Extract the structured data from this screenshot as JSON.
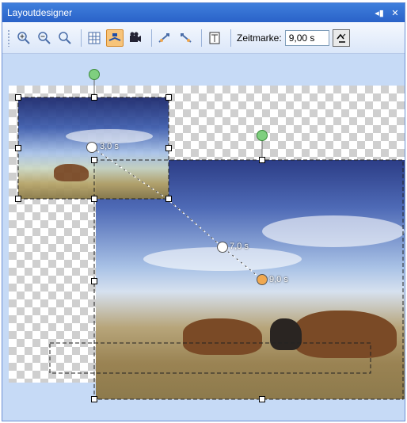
{
  "window": {
    "title": "Layoutdesigner",
    "controls": {
      "pin": "◂ ▯",
      "close": "×"
    }
  },
  "toolbar": {
    "zeitmarke_label": "Zeitmarke:",
    "zeitmarke_value": "9,00 s",
    "icons": [
      "zoom-in-icon",
      "zoom-out-icon",
      "zoom-fit-icon",
      "grid-icon",
      "camera-path-icon",
      "film-icon",
      "add-keyframe-icon",
      "remove-keyframe-icon",
      "properties-icon"
    ]
  },
  "keyframes": [
    {
      "label": "3,0 s",
      "color": "#ffffff"
    },
    {
      "label": "7,0 s",
      "color": "#ffffff"
    },
    {
      "label": "9,0 s",
      "color": "#f0a850"
    }
  ],
  "colors": {
    "title_bar": "#2a62c8",
    "rotate_handle": "#7fcf7f",
    "active_keyframe": "#f0a850"
  }
}
